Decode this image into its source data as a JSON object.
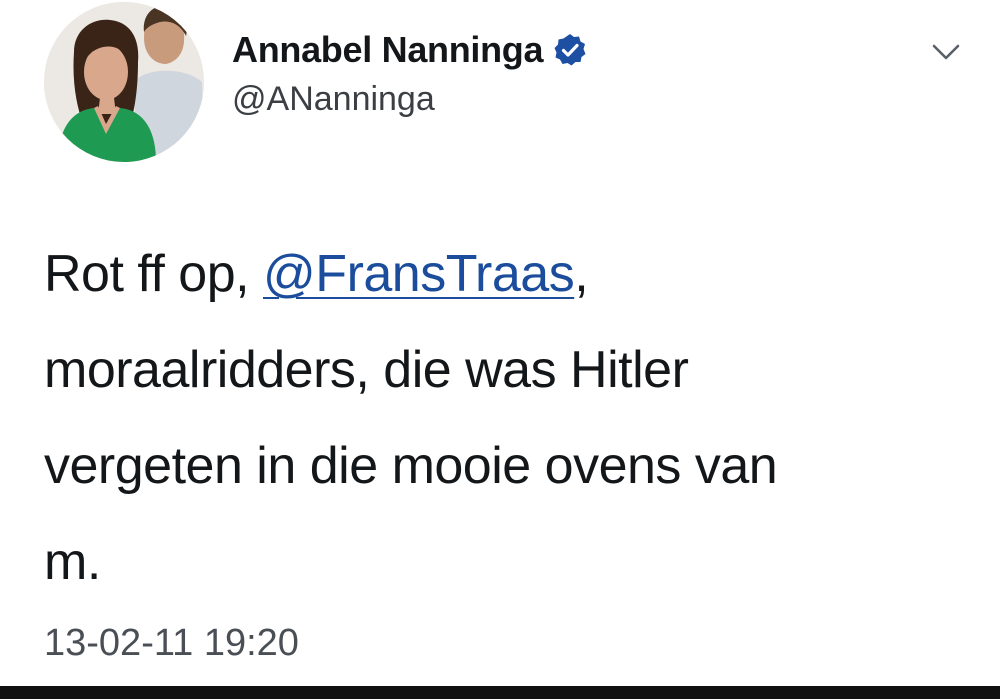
{
  "author": {
    "display_name": "Annabel Nanninga",
    "handle": "@ANanninga",
    "verified": true,
    "verified_icon": "verified-badge-icon",
    "avatar_icon": "avatar-photo"
  },
  "menu": {
    "icon": "chevron-down-icon"
  },
  "tweet": {
    "text_lines": {
      "l1_before": "Rot ff op, ",
      "l1_mention": "@FransTraas",
      "l1_after": ",",
      "l2": "moraalridders, die was Hitler",
      "l3": "vergeten in die mooie ovens van",
      "l4": "m."
    },
    "timestamp": "13-02-11 19:20"
  },
  "colors": {
    "mention": "#1b4d9c",
    "verified_badge": "#1d4fa3",
    "text": "#14171a"
  }
}
